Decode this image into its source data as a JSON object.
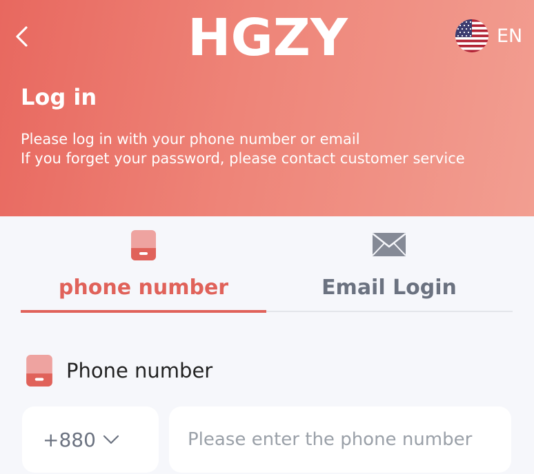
{
  "header": {
    "logo_text": "HGZY",
    "language_label": "EN",
    "title": "Log in",
    "subtitle_line1": "Please log in with your phone number or email",
    "subtitle_line2": "If you forget your password, please contact customer service"
  },
  "tabs": [
    {
      "label": "phone number",
      "icon": "phone-icon",
      "active": true
    },
    {
      "label": "Email Login",
      "icon": "envelope-icon",
      "active": false
    }
  ],
  "form": {
    "phone_label": "Phone number",
    "country_code": "+880",
    "phone_placeholder": "Please enter the phone number"
  },
  "colors": {
    "accent": "#e0625a",
    "hero_start": "#e8685f",
    "hero_end": "#f29e91",
    "inactive_text": "#6b7280",
    "page_bg": "#f6f7fb"
  }
}
